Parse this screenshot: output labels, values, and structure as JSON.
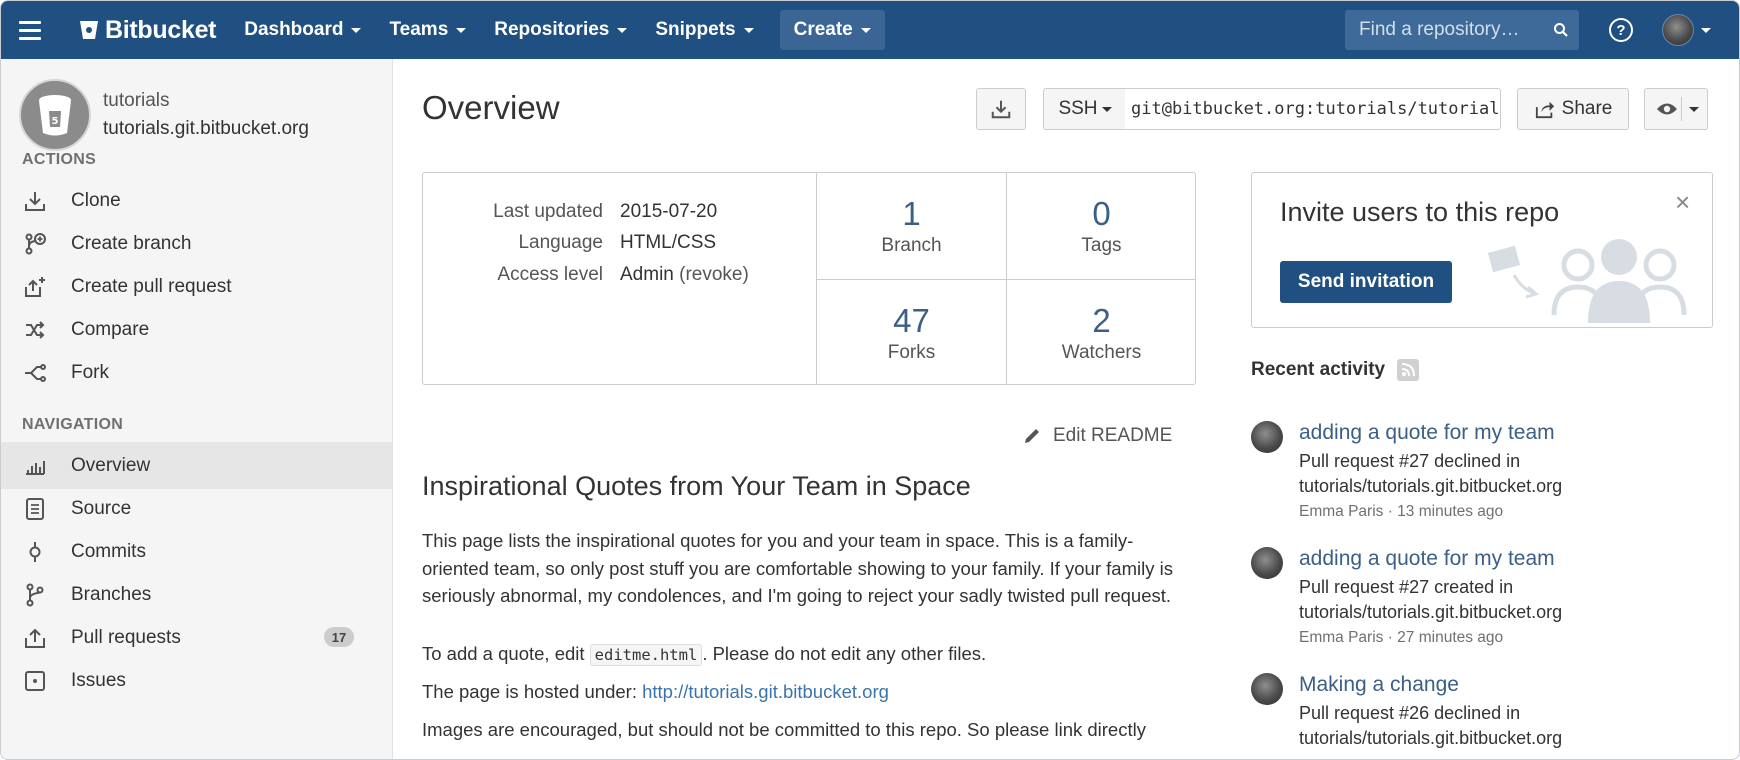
{
  "topbar": {
    "brand": "Bitbucket",
    "nav": [
      {
        "label": "Dashboard"
      },
      {
        "label": "Teams"
      },
      {
        "label": "Repositories"
      },
      {
        "label": "Snippets"
      }
    ],
    "create_label": "Create",
    "search_placeholder": "Find a repository…",
    "help_glyph": "?"
  },
  "sidebar": {
    "repo_name": "tutorials",
    "repo_host": "tutorials.git.bitbucket.org",
    "actions_heading": "ACTIONS",
    "actions": [
      {
        "label": "Clone",
        "icon": "download-icon"
      },
      {
        "label": "Create branch",
        "icon": "branch-plus-icon"
      },
      {
        "label": "Create pull request",
        "icon": "pull-request-plus-icon"
      },
      {
        "label": "Compare",
        "icon": "compare-icon"
      },
      {
        "label": "Fork",
        "icon": "fork-icon"
      }
    ],
    "navigation_heading": "NAVIGATION",
    "navigation": [
      {
        "label": "Overview",
        "icon": "overview-icon",
        "active": true
      },
      {
        "label": "Source",
        "icon": "source-icon"
      },
      {
        "label": "Commits",
        "icon": "commit-icon"
      },
      {
        "label": "Branches",
        "icon": "branches-icon"
      },
      {
        "label": "Pull requests",
        "icon": "pull-requests-icon",
        "badge": "17"
      },
      {
        "label": "Issues",
        "icon": "issues-icon"
      }
    ]
  },
  "main": {
    "title": "Overview",
    "clone_protocol": "SSH",
    "clone_url": "git@bitbucket.org:tutorials/tutorials.git.bitbucket.org.git",
    "share_label": "Share",
    "meta": {
      "last_updated_label": "Last updated",
      "last_updated": "2015-07-20",
      "language_label": "Language",
      "language": "HTML/CSS",
      "access_label": "Access level",
      "access": "Admin",
      "revoke": "(revoke)"
    },
    "stats": [
      {
        "num": "1",
        "label": "Branch"
      },
      {
        "num": "0",
        "label": "Tags"
      },
      {
        "num": "47",
        "label": "Forks"
      },
      {
        "num": "2",
        "label": "Watchers"
      }
    ],
    "edit_readme": "Edit README",
    "readme": {
      "title": "Inspirational Quotes from Your Team in Space",
      "p1": "This page lists the inspirational quotes for you and your team in space. This is a family-oriented team, so only post stuff you are comfortable showing to your family. If your family is seriously abnormal, my condolences, and I'm going to reject your sadly twisted pull request.",
      "p2_before": "To add a quote, edit ",
      "p2_code": "editme.html",
      "p2_after": ". Please do not edit any other files.",
      "p3_before": "The page is hosted under: ",
      "p3_link": "http://tutorials.git.bitbucket.org",
      "p4": "Images are encouraged, but should not be committed to this repo. So please link directly"
    }
  },
  "invite": {
    "title": "Invite users to this repo",
    "button": "Send invitation",
    "close": "×"
  },
  "recent": {
    "heading": "Recent activity",
    "items": [
      {
        "title": "adding a quote for my team",
        "line1": "Pull request #27 declined in",
        "line2": "tutorials/tutorials.git.bitbucket.org",
        "meta": "Emma Paris · 13 minutes ago"
      },
      {
        "title": "adding a quote for my team",
        "line1": "Pull request #27 created in",
        "line2": "tutorials/tutorials.git.bitbucket.org",
        "meta": "Emma Paris · 27 minutes ago"
      },
      {
        "title": "Making a change",
        "line1": "Pull request #26 declined in",
        "line2": "tutorials/tutorials.git.bitbucket.org",
        "meta": ""
      }
    ]
  },
  "colors": {
    "topbar": "#205081",
    "link": "#3b73af",
    "stat_number": "#3b5f86"
  }
}
